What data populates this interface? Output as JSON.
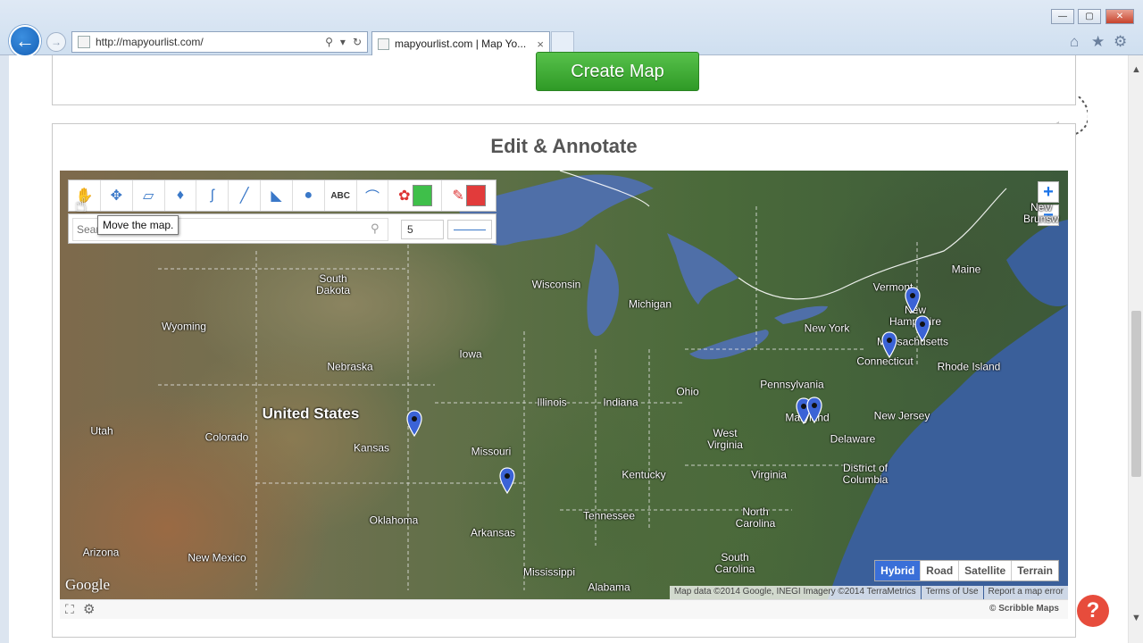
{
  "browser": {
    "back_glyph": "←",
    "forward_glyph": "→",
    "url": "http://mapyourlist.com/",
    "tab_title": "mapyourlist.com | Map Yo...",
    "tab_close": "×",
    "search_glyph": "⚲",
    "refresh_glyph": "↻",
    "home_glyph": "⌂",
    "star_glyph": "★",
    "gear_glyph": "⚙",
    "minimize_glyph": "—",
    "maximize_glyph": "▢",
    "close_glyph": "✕"
  },
  "page": {
    "create_map_label": "Create Map",
    "edit_title": "Edit & Annotate",
    "help_glyph": "?"
  },
  "map": {
    "toolbar_icons": [
      "hand-icon",
      "move-icon",
      "eraser-icon",
      "fill-icon",
      "freehand-icon",
      "line-icon",
      "polygon-icon",
      "circle-icon",
      "text-icon",
      "measure-icon"
    ],
    "text_tool_label": "ABC",
    "search_placeholder": "Search",
    "stroke_width": "5",
    "tooltip": "Move the map.",
    "zoom_in": "+",
    "zoom_out": "−",
    "map_types": [
      "Hybrid",
      "Road",
      "Satellite",
      "Terrain"
    ],
    "active_map_type": "Hybrid",
    "google_logo": "Google",
    "attribution": [
      "Map data ©2014 Google, INEGI Imagery ©2014 TerraMetrics",
      "Terms of Use",
      "Report a map error"
    ],
    "credit": "© Scribble Maps",
    "colors": {
      "fill": "#3fbf4a",
      "line": "#e23b3b",
      "water": "#4f6fa8",
      "marker": "#3b63d6"
    },
    "places": {
      "united_states": "United States",
      "south_dakota": "South\nDakota",
      "wyoming": "Wyoming",
      "nebraska": "Nebraska",
      "iowa": "Iowa",
      "wisconsin": "Wisconsin",
      "michigan": "Michigan",
      "illinois": "Illinois",
      "indiana": "Indiana",
      "ohio": "Ohio",
      "utah": "Utah",
      "colorado": "Colorado",
      "kansas": "Kansas",
      "missouri": "Missouri",
      "kentucky": "Kentucky",
      "west_virginia": "West\nVirginia",
      "virginia": "Virginia",
      "oklahoma": "Oklahoma",
      "arkansas": "Arkansas",
      "tennessee": "Tennessee",
      "north_carolina": "North\nCarolina",
      "south_carolina": "South\nCarolina",
      "arizona": "Arizona",
      "new_mexico": "New Mexico",
      "mississippi": "Mississippi",
      "alabama": "Alabama",
      "pennsylvania": "Pennsylvania",
      "new_york": "New York",
      "maryland": "Maryland",
      "delaware": "Delaware",
      "new_jersey": "New Jersey",
      "district_of_columbia": "District of\nColumbia",
      "connecticut": "Connecticut",
      "rhode_island": "Rhode Island",
      "massachusetts": "Massachusetts",
      "new_hampshire": "New\nHampshire",
      "vermont": "Vermont",
      "maine": "Maine",
      "new_brunswick": "New\nBrunsw"
    }
  }
}
